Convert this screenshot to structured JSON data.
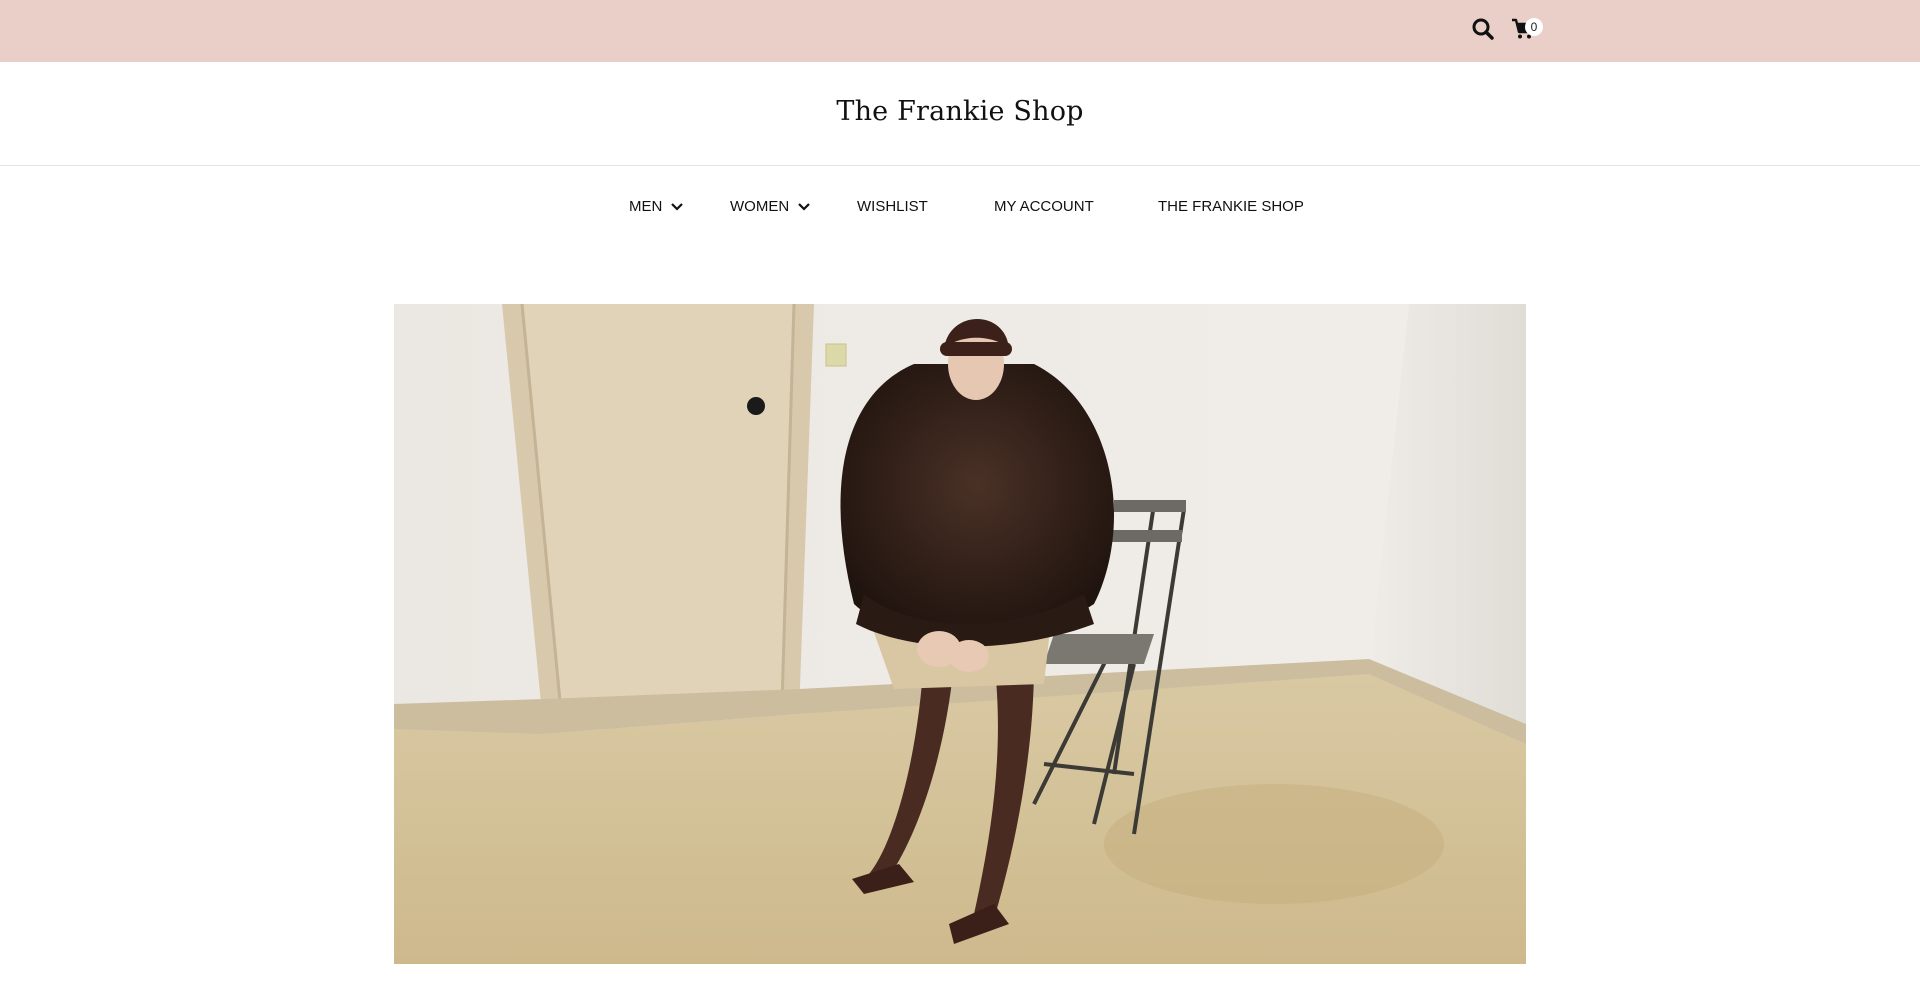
{
  "topbar": {
    "background": "#e9cfc7",
    "search_icon": "search-icon",
    "cart_icon": "cart-icon",
    "cart_count": "0"
  },
  "brand": {
    "name": "The Frankie Shop"
  },
  "nav": {
    "items": [
      {
        "label": "MEN",
        "icon": "chevron-down-icon"
      },
      {
        "label": "WOMEN",
        "icon": "chevron-down-icon"
      },
      {
        "label": "WISHLIST"
      },
      {
        "label": "MY ACCOUNT"
      },
      {
        "label": "THE FRANKIE SHOP"
      }
    ]
  },
  "hero": {
    "image": "model-in-fur-coat-photo"
  }
}
